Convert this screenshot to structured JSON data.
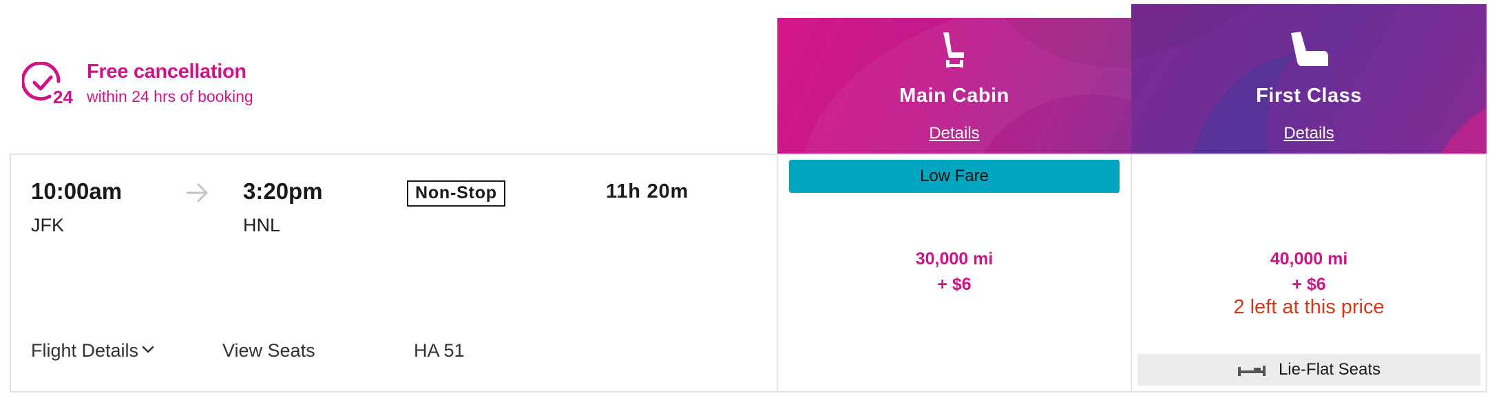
{
  "cancellation": {
    "icon": "clock-24-icon",
    "icon_number": "24",
    "title": "Free cancellation",
    "subtitle": "within 24 hrs of booking"
  },
  "cabins": [
    {
      "name": "Main Cabin",
      "details_label": "Details",
      "icon": "economy-seat-icon"
    },
    {
      "name": "First Class",
      "details_label": "Details",
      "icon": "first-class-seat-icon"
    }
  ],
  "flight": {
    "depart_time": "10:00am",
    "depart_airport": "JFK",
    "arrive_time": "3:20pm",
    "arrive_airport": "HNL",
    "stops_badge": "Non-Stop",
    "duration": "11h 20m",
    "details_link": "Flight Details",
    "seats_link": "View Seats",
    "flight_number": "HA 51"
  },
  "fares": {
    "main": {
      "badge": "Low Fare",
      "miles": "30,000 mi",
      "fee": "+ $6"
    },
    "first": {
      "miles": "40,000 mi",
      "fee": "+ $6",
      "availability": "2 left at this price",
      "feature": "Lie-Flat Seats",
      "feature_icon": "lie-flat-bed-icon"
    }
  },
  "colors": {
    "brand_magenta": "#cf1487",
    "brand_purple": "#6a2f97",
    "low_fare_teal": "#00a5c0",
    "availability_red": "#d2391c"
  }
}
